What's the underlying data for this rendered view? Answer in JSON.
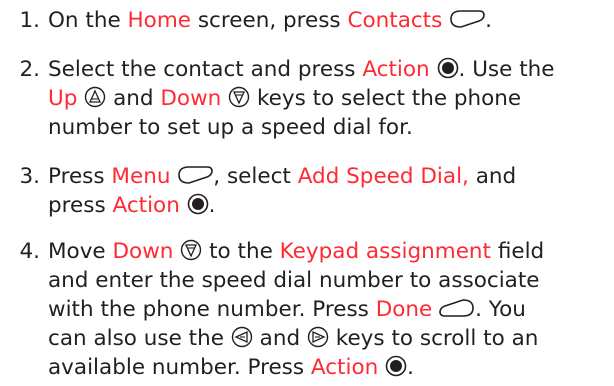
{
  "colors": {
    "text": "#231f20",
    "highlight": "#ff2a34"
  },
  "steps": [
    {
      "number": "1.",
      "lines": [
        [
          {
            "t": "text",
            "v": "On the "
          },
          {
            "t": "hl",
            "v": "Home"
          },
          {
            "t": "text",
            "v": " screen, press "
          },
          {
            "t": "hl",
            "v": "Contacts"
          },
          {
            "t": "text",
            "v": " "
          },
          {
            "t": "icon",
            "v": "left-softkey-icon"
          },
          {
            "t": "text",
            "v": "."
          }
        ]
      ]
    },
    {
      "number": "2.",
      "lines": [
        [
          {
            "t": "text",
            "v": "Select the contact and press "
          },
          {
            "t": "hl",
            "v": "Action"
          },
          {
            "t": "text",
            "v": " "
          },
          {
            "t": "icon",
            "v": "action-key-icon"
          },
          {
            "t": "text",
            "v": ". Use the"
          }
        ],
        [
          {
            "t": "hl",
            "v": "Up"
          },
          {
            "t": "text",
            "v": " "
          },
          {
            "t": "icon",
            "v": "up-key-icon"
          },
          {
            "t": "text",
            "v": " and "
          },
          {
            "t": "hl",
            "v": "Down"
          },
          {
            "t": "text",
            "v": " "
          },
          {
            "t": "icon",
            "v": "down-key-icon"
          },
          {
            "t": "text",
            "v": " keys to select the phone"
          }
        ],
        [
          {
            "t": "text",
            "v": "number to set up a speed dial for."
          }
        ]
      ]
    },
    {
      "number": "3.",
      "lines": [
        [
          {
            "t": "text",
            "v": "Press "
          },
          {
            "t": "hl",
            "v": "Menu"
          },
          {
            "t": "text",
            "v": " "
          },
          {
            "t": "icon",
            "v": "left-softkey-icon"
          },
          {
            "t": "text",
            "v": ", select "
          },
          {
            "t": "hl",
            "v": "Add Speed Dial,"
          },
          {
            "t": "text",
            "v": " and"
          }
        ],
        [
          {
            "t": "text",
            "v": "press "
          },
          {
            "t": "hl",
            "v": "Action"
          },
          {
            "t": "text",
            "v": " "
          },
          {
            "t": "icon",
            "v": "action-key-icon"
          },
          {
            "t": "text",
            "v": "."
          }
        ]
      ]
    },
    {
      "number": "4.",
      "lines": [
        [
          {
            "t": "text",
            "v": "Move "
          },
          {
            "t": "hl",
            "v": "Down"
          },
          {
            "t": "text",
            "v": " "
          },
          {
            "t": "icon",
            "v": "down-key-icon"
          },
          {
            "t": "text",
            "v": " to the "
          },
          {
            "t": "hl",
            "v": "Keypad assignment"
          },
          {
            "t": "text",
            "v": " field"
          }
        ],
        [
          {
            "t": "text",
            "v": "and enter the speed dial number to associate"
          }
        ],
        [
          {
            "t": "text",
            "v": "with the phone number. Press "
          },
          {
            "t": "hl",
            "v": "Done"
          },
          {
            "t": "text",
            "v": " "
          },
          {
            "t": "icon",
            "v": "right-softkey-icon"
          },
          {
            "t": "text",
            "v": ". You"
          }
        ],
        [
          {
            "t": "text",
            "v": "can also use the "
          },
          {
            "t": "icon",
            "v": "left-key-icon"
          },
          {
            "t": "text",
            "v": " and "
          },
          {
            "t": "icon",
            "v": "right-key-icon"
          },
          {
            "t": "text",
            "v": " keys to scroll to an"
          }
        ],
        [
          {
            "t": "text",
            "v": "available number. Press "
          },
          {
            "t": "hl",
            "v": "Action"
          },
          {
            "t": "text",
            "v": " "
          },
          {
            "t": "icon",
            "v": "action-key-icon"
          },
          {
            "t": "text",
            "v": "."
          }
        ]
      ]
    }
  ]
}
